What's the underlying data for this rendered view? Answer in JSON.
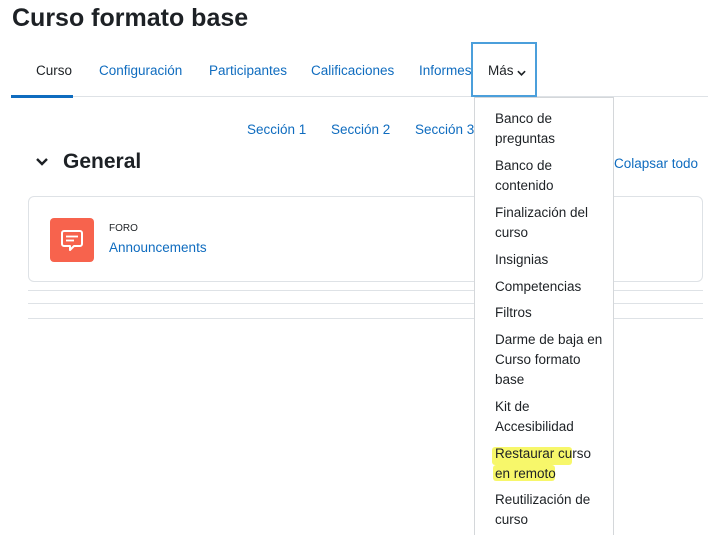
{
  "course": {
    "title": "Curso formato base"
  },
  "tabs": [
    {
      "label": "Curso"
    },
    {
      "label": "Configuración"
    },
    {
      "label": "Participantes"
    },
    {
      "label": "Calificaciones"
    },
    {
      "label": "Informes"
    },
    {
      "label": "Más"
    }
  ],
  "sections_nav": [
    {
      "label": "Sección 1"
    },
    {
      "label": "Sección 2"
    },
    {
      "label": "Sección 3"
    }
  ],
  "general": {
    "title": "General",
    "collapse_all": "Colapsar todo"
  },
  "activity": {
    "type": "FORO",
    "name": "Announcements",
    "icon": "forum-icon"
  },
  "more_menu": [
    {
      "label": "Banco de preguntas"
    },
    {
      "label": "Banco de contenido"
    },
    {
      "label": "Finalización del curso"
    },
    {
      "label": "Insignias"
    },
    {
      "label": "Competencias"
    },
    {
      "label": "Filtros"
    },
    {
      "label": "Darme de baja en Curso formato base"
    },
    {
      "label": "Kit de Accesibilidad"
    },
    {
      "label": "Restaurar curso en remoto",
      "highlighted": true
    },
    {
      "label": "Reutilización de curso"
    }
  ],
  "colors": {
    "link": "#0f6cbf",
    "text": "#1d2125",
    "forum_icon_bg": "#f7634d",
    "highlight": "#f7f76a",
    "active_border": "#4b9fdb"
  }
}
